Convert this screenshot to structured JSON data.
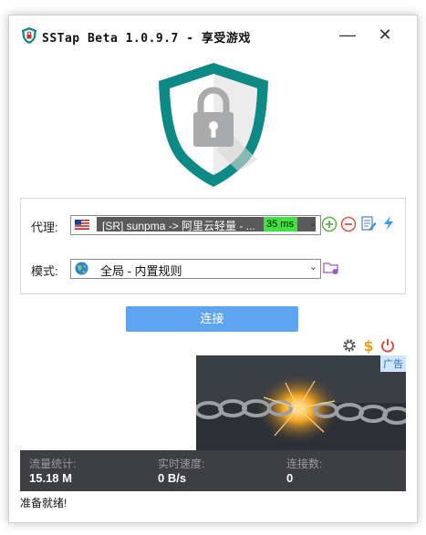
{
  "window": {
    "title": "SSTap Beta 1.0.9.7 - 享受游戏",
    "minimize_glyph": "—",
    "close_glyph": "✕"
  },
  "proxy": {
    "label": "代理:",
    "selected": "[SR] sunpma -> 阿里云轻量 - ...",
    "latency": "35 ms",
    "flag_icon": "us-flag-icon"
  },
  "mode": {
    "label": "模式:",
    "selected": "全局 - 内置规则"
  },
  "connect_button": "连接",
  "ad": {
    "tag": "广告"
  },
  "stats": {
    "traffic_label": "流量统计:",
    "traffic_value": "15.18 M",
    "speed_label": "实时速度:",
    "speed_value": "0 B/s",
    "connections_label": "连接数:",
    "connections_value": "0"
  },
  "status_text": "准备就绪!",
  "colors": {
    "accent": "#5ea4f0",
    "shield_teal": "#0e8a86",
    "latency_green": "#3ee33e",
    "stats_bg": "#3d3f42"
  }
}
